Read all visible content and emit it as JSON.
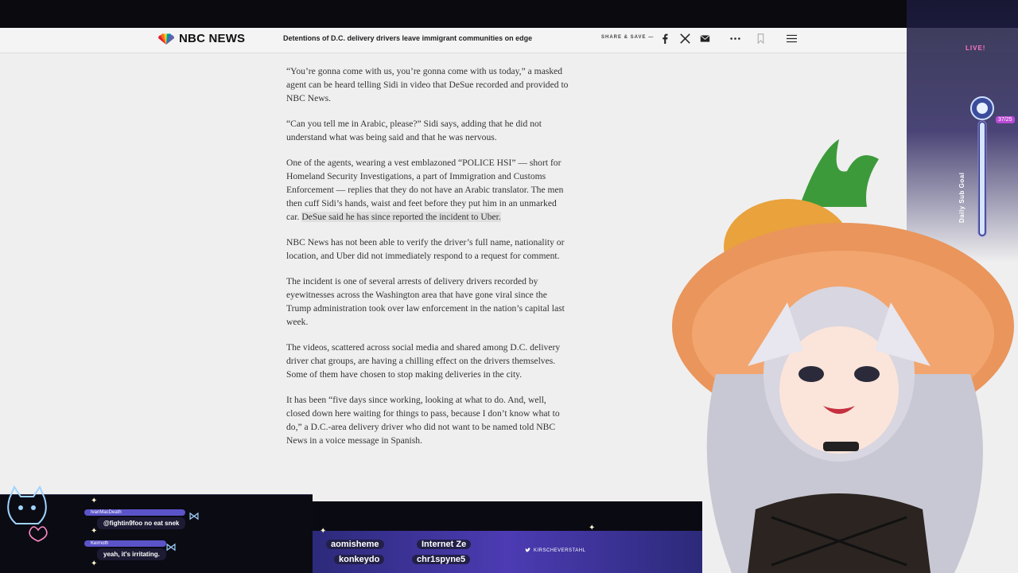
{
  "site": {
    "logo_text": "NBC NEWS",
    "headline": "Detentions of D.C. delivery drivers leave immigrant communities on edge",
    "share_label": "SHARE & SAVE —"
  },
  "article": {
    "paragraphs": [
      "“You’re gonna come with us, you’re gonna come with us today,” a masked agent can be heard telling Sidi in video that DeSue recorded and provided to NBC News.",
      "“Can you tell me in Arabic, please?” Sidi says, adding that he did not understand what was being said and that he was nervous.",
      "One of the agents, wearing a vest emblazoned “POLICE HSI” — short for Homeland Security Investigations, a part of Immigration and Customs Enforcement — replies that they do not have an Arabic translator. The men then cuff Sidi’s hands, waist and feet before they put him in an unmarked car. ",
      "NBC News has not been able to verify the driver’s full name, nationality or location, and Uber did not immediately respond to a request for comment.",
      "The incident is one of several arrests of delivery drivers recorded by eyewitnesses across the Washington area that have gone viral since the Trump administration took over law enforcement in the nation’s capital last week.",
      "The videos, scattered across social media and shared among D.C. delivery driver chat groups, are having a chilling effect on the drivers themselves. Some of them have chosen to stop making deliveries in the city.",
      "It has been “five days since working, looking at what to do. And, well, closed down here waiting for things to pass, because I don’t know what to do,” a D.C.-area delivery driver who did not want to be named told NBC News in a voice message in Spanish."
    ],
    "highlight": "DeSue said he has since reported the incident to Uber."
  },
  "stream": {
    "live_label": "LIVE!",
    "goal_label": "Daily Sub Goal",
    "goal_count": "37/25",
    "twitter_handle": "KIRSCHEVERSTAHL",
    "chat": [
      {
        "user": "IvanMacDeath",
        "text": "@fightin9foo no eat snek"
      },
      {
        "user": "Keirnoth",
        "text": "yeah, it's irritating."
      }
    ],
    "subs": [
      "aomisheme",
      "Internet Ze",
      "konkeydo",
      "chr1spyne5"
    ]
  },
  "colors": {
    "page_bg": "#efefef",
    "text": "#333333",
    "chat_name_bg": "#5b54c9",
    "stream_accent": "#b94ad4"
  }
}
